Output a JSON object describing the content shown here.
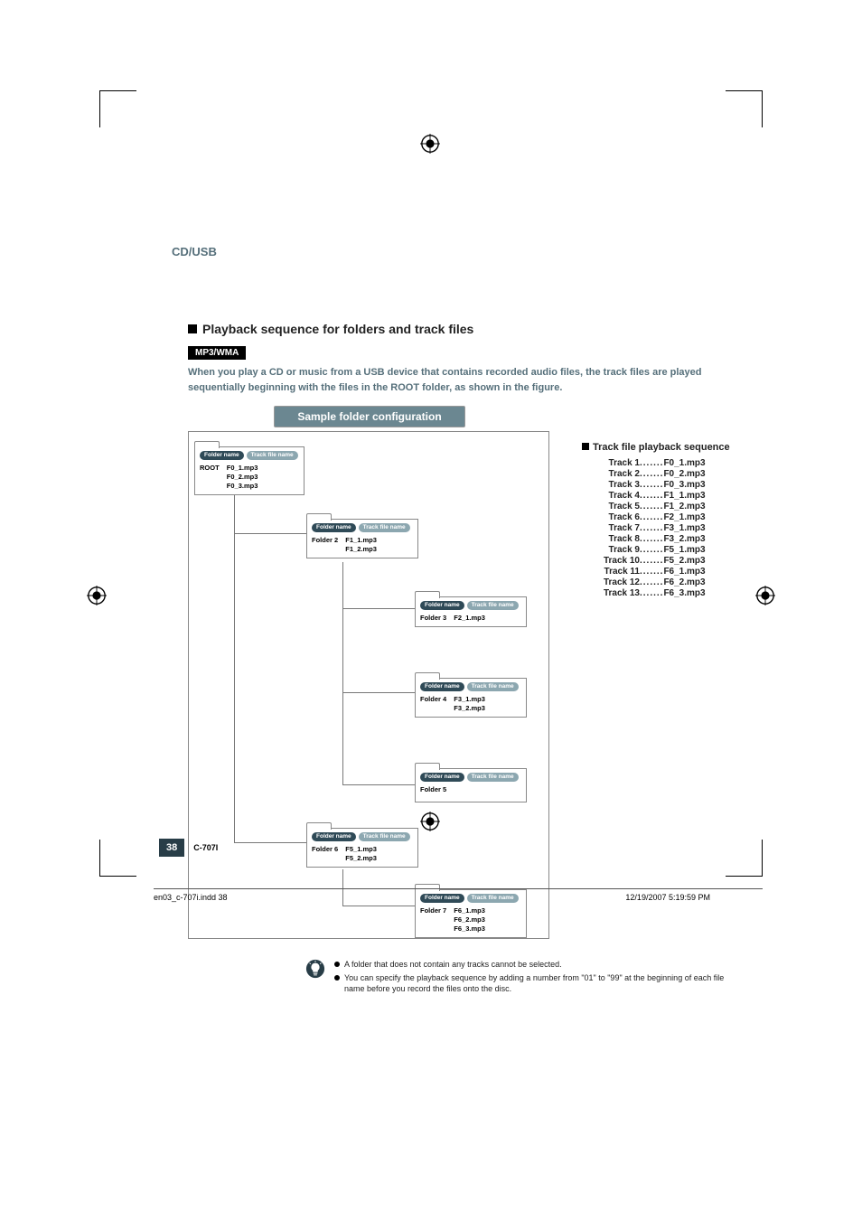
{
  "breadcrumb": "CD/USB",
  "section_title": "Playback sequence for folders and track files",
  "tag": "MP3/WMA",
  "intro": "When you play a CD or music from a USB device that contains recorded audio files, the track files are played sequentially beginning with the files in the ROOT folder, as shown in the figure.",
  "diagram_title": "Sample folder configuration",
  "pill_folder": "Folder name",
  "pill_track": "Track file name",
  "folders": {
    "root": {
      "name": "ROOT",
      "tracks": [
        "F0_1.mp3",
        "F0_2.mp3",
        "F0_3.mp3"
      ]
    },
    "f2": {
      "name": "Folder 2",
      "tracks": [
        "F1_1.mp3",
        "F1_2.mp3"
      ]
    },
    "f3": {
      "name": "Folder 3",
      "tracks": [
        "F2_1.mp3"
      ]
    },
    "f4": {
      "name": "Folder 4",
      "tracks": [
        "F3_1.mp3",
        "F3_2.mp3"
      ]
    },
    "f5": {
      "name": "Folder 5",
      "tracks": []
    },
    "f6": {
      "name": "Folder 6",
      "tracks": [
        "F5_1.mp3",
        "F5_2.mp3"
      ]
    },
    "f7": {
      "name": "Folder 7",
      "tracks": [
        "F6_1.mp3",
        "F6_2.mp3",
        "F6_3.mp3"
      ]
    }
  },
  "sequence": {
    "title": "Track file playback sequence",
    "rows": [
      {
        "label": "Track 1",
        "file": "F0_1.mp3"
      },
      {
        "label": "Track 2",
        "file": "F0_2.mp3"
      },
      {
        "label": "Track 3",
        "file": "F0_3.mp3"
      },
      {
        "label": "Track 4",
        "file": "F1_1.mp3"
      },
      {
        "label": "Track 5",
        "file": "F1_2.mp3"
      },
      {
        "label": "Track 6",
        "file": "F2_1.mp3"
      },
      {
        "label": "Track 7",
        "file": "F3_1.mp3"
      },
      {
        "label": "Track 8",
        "file": "F3_2.mp3"
      },
      {
        "label": "Track 9",
        "file": "F5_1.mp3"
      },
      {
        "label": "Track 10",
        "file": "F5_2.mp3"
      },
      {
        "label": "Track 11",
        "file": "F6_1.mp3"
      },
      {
        "label": "Track 12",
        "file": "F6_2.mp3"
      },
      {
        "label": "Track 13",
        "file": "F6_3.mp3"
      }
    ]
  },
  "notes": [
    "A folder that does not contain any tracks cannot be selected.",
    "You can specify the playback sequence by adding a number from \"01\" to \"99\" at the beginning of each file name before you record the files onto the disc."
  ],
  "page_number": "38",
  "model": "C-707I",
  "print_footer_left": "en03_c-707i.indd   38",
  "print_footer_right": "12/19/2007   5:19:59 PM"
}
